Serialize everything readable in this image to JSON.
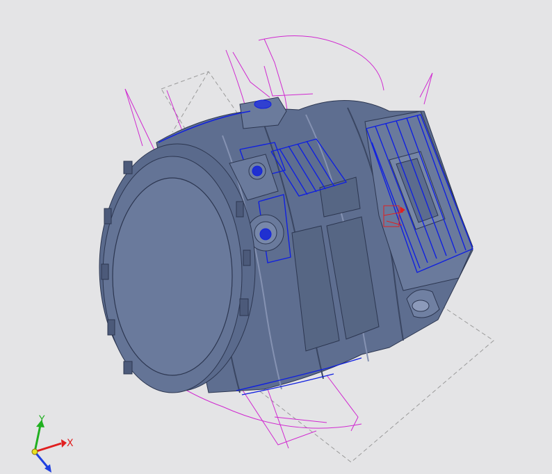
{
  "triad": {
    "x_label": "X",
    "y_label": "Y",
    "x_color": "#e02020",
    "y_color": "#20b020",
    "z_color": "#2040e0"
  },
  "colors": {
    "background": "#e4e4e6",
    "body": "#647496",
    "body_dark": "#4c5a7a",
    "body_light": "#8290b0",
    "sketch": "#d028d0",
    "feature": "#1020e0",
    "construction": "#9a9a9a",
    "marker": "#e02020"
  }
}
